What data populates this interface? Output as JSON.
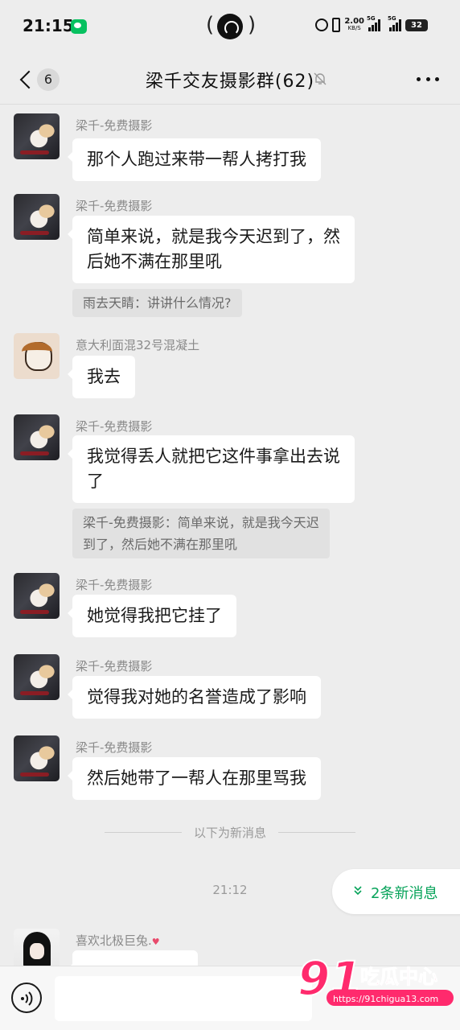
{
  "status_bar": {
    "time": "21:15",
    "net_speed": "2.00",
    "net_unit": "KB/S",
    "signal_1": "5G",
    "signal_2": "5G",
    "battery": "32"
  },
  "header": {
    "unread_count": "6",
    "title": "梁千交友摄影群(62)"
  },
  "messages": [
    {
      "sender": "梁千-免费摄影",
      "text": "那个人跑过来带一帮人拷打我"
    },
    {
      "sender": "梁千-免费摄影",
      "text_line1": "简单来说，就是我今天迟到了，然",
      "text_line2": "后她不满在那里吼",
      "quote": "雨去天睛：讲讲什么情况?"
    },
    {
      "sender": "意大利面混32号混凝土",
      "text": "我去"
    },
    {
      "sender": "梁千-免费摄影",
      "text_line1": "我觉得丢人就把它这件事拿出去说",
      "text_line2": "了",
      "quote_line1": "梁千-免费摄影：简单来说，就是我今天迟",
      "quote_line2": "到了，然后她不满在那里吼"
    },
    {
      "sender": "梁千-免费摄影",
      "text": "她觉得我把它挂了"
    },
    {
      "sender": "梁千-免费摄影",
      "text": "觉得我对她的名誉造成了影响"
    },
    {
      "sender": "梁千-免费摄影",
      "text": "然后她带了一帮人在那里骂我"
    },
    {
      "sender": "喜欢北极巨兔.",
      "sender_emoji": "♥"
    }
  ],
  "divider_text": "以下为新消息",
  "time_label": "21:12",
  "new_messages_pill": "2条新消息",
  "input": {
    "value": ""
  },
  "watermark": {
    "brand_number": "91",
    "brand_text": "吃瓜中心",
    "url": "https://91chigua13.com"
  },
  "colors": {
    "background": "#ededed",
    "bubble": "#ffffff",
    "accent_green": "#07c160",
    "pill_text": "#07a35a",
    "watermark_pink": "#ff2a6d"
  }
}
